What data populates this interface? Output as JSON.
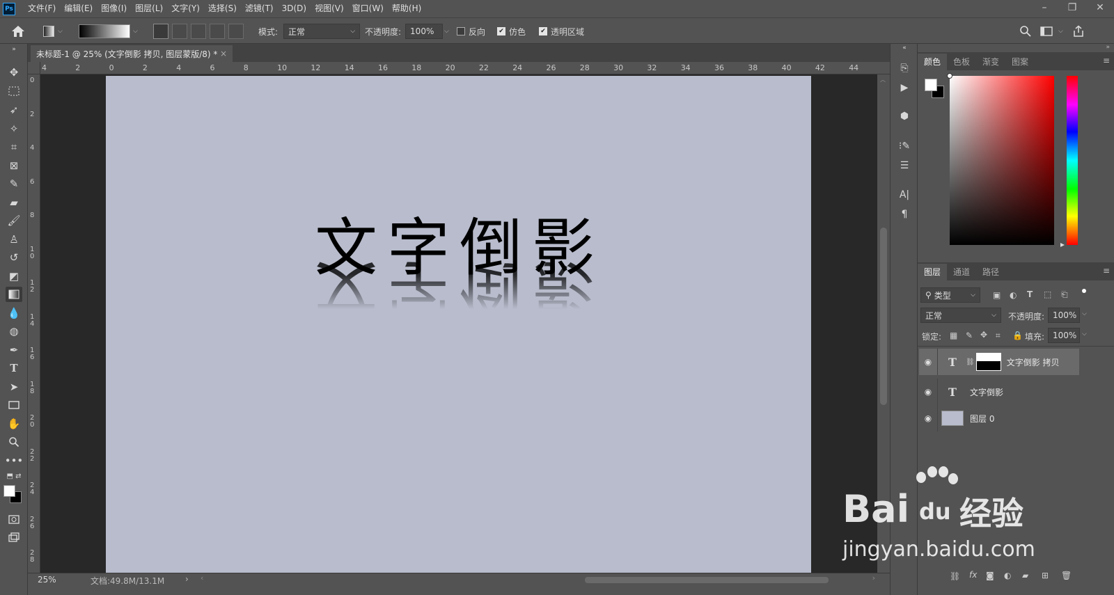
{
  "app": {
    "logo": "Ps"
  },
  "menu": [
    "文件(F)",
    "编辑(E)",
    "图像(I)",
    "图层(L)",
    "文字(Y)",
    "选择(S)",
    "滤镜(T)",
    "3D(D)",
    "视图(V)",
    "窗口(W)",
    "帮助(H)"
  ],
  "window_controls": {
    "minimize": "–",
    "restore": "❐",
    "close": "✕"
  },
  "options": {
    "mode_label": "模式:",
    "mode_value": "正常",
    "opacity_label": "不透明度:",
    "opacity_value": "100%",
    "reverse_label": "反向",
    "reverse_checked": false,
    "dither_label": "仿色",
    "dither_checked": true,
    "transparency_label": "透明区域",
    "transparency_checked": true
  },
  "document": {
    "tab_title": "未标题-1 @ 25% (文字倒影 拷贝, 图层蒙版/8) *",
    "tab_close": "×",
    "canvas_text": "文字倒影",
    "canvas_color": "#b8bccc",
    "ruler_top": [
      "4",
      "2",
      "0",
      "2",
      "4",
      "6",
      "8",
      "10",
      "12",
      "14",
      "16",
      "18",
      "20",
      "22",
      "24",
      "26",
      "28",
      "30",
      "32",
      "34",
      "36",
      "38",
      "40",
      "42",
      "44"
    ],
    "ruler_left": [
      "0",
      "2",
      "4",
      "6",
      "8",
      "1 0",
      "1 2",
      "1 4",
      "1 6",
      "1 8",
      "2 0",
      "2 2",
      "2 4",
      "2 6",
      "2 8"
    ]
  },
  "status": {
    "zoom": "25%",
    "doc_size": "文档:49.8M/13.1M"
  },
  "color_panel": {
    "tabs": [
      "颜色",
      "色板",
      "渐变",
      "图案"
    ],
    "active": 0
  },
  "layers_panel": {
    "tabs": [
      "图层",
      "通道",
      "路径"
    ],
    "filter_label": "类型",
    "blend_mode": "正常",
    "opacity_label": "不透明度:",
    "opacity_value": "100%",
    "lock_label": "锁定:",
    "fill_label": "填充:",
    "fill_value": "100%",
    "layers": [
      {
        "name": "文字倒影 拷贝",
        "type": "text",
        "has_mask": true,
        "selected": true
      },
      {
        "name": "文字倒影",
        "type": "text",
        "has_mask": false,
        "selected": false
      },
      {
        "name": "图层 0",
        "type": "pixel",
        "has_mask": false,
        "selected": false
      }
    ]
  },
  "watermark": {
    "brand": "Bai",
    "brand2": "du",
    "brand3": "经验",
    "url": "jingyan.baidu.com"
  }
}
